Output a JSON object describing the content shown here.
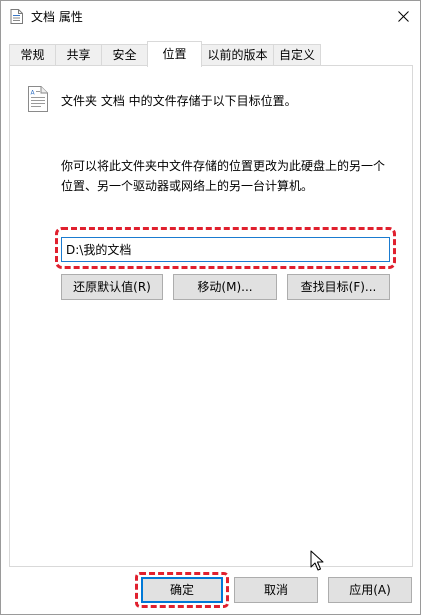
{
  "window": {
    "title": "文档 属性",
    "close_glyph": "✕"
  },
  "tabs": [
    {
      "label": "常规",
      "active": false
    },
    {
      "label": "共享",
      "active": false
    },
    {
      "label": "安全",
      "active": false
    },
    {
      "label": "位置",
      "active": true
    },
    {
      "label": "以前的版本",
      "active": false
    },
    {
      "label": "自定义",
      "active": false
    }
  ],
  "location": {
    "header": "文件夹 文档 中的文件存储于以下目标位置。",
    "description_line1": "你可以将此文件夹中文件存储的位置更改为此硬盘上的另一个",
    "description_line2": "位置、另一个驱动器或网络上的另一台计算机。",
    "path_value": "D:\\我的文档",
    "restore_default_label": "还原默认值(R)",
    "move_label": "移动(M)...",
    "find_target_label": "查找目标(F)..."
  },
  "footer": {
    "ok_label": "确定",
    "cancel_label": "取消",
    "apply_label": "应用(A)"
  },
  "colors": {
    "highlight": "#e0202e",
    "focus_accent": "#0078d7",
    "button_face": "#e1e1e1"
  },
  "icons": {
    "title": "document-icon",
    "close": "close-icon",
    "header": "document-folder-icon",
    "cursor": "mouse-pointer-icon"
  }
}
